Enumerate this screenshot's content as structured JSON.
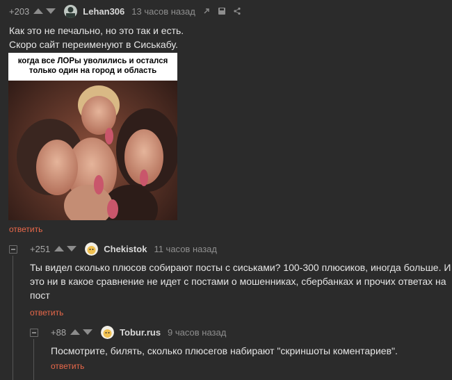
{
  "comments": [
    {
      "score": "+203",
      "user": "Lehan306",
      "time": "13 часов назад",
      "text_lines": [
        "Как это не печально, но это так и есть.",
        "Скоро сайт переименуют в Сиськабу."
      ],
      "image_caption": "когда все ЛОРы уволились и остался только один на город и область",
      "reply": "ответить"
    },
    {
      "score": "+251",
      "user": "Chekistok",
      "time": "11 часов назад",
      "text_lines": [
        "Ты видел сколько плюсов собирают посты с сиськами? 100-300 плюсиков, иногда больше. И",
        "это ни в какое сравнение не идет с постами о мошенниках, сбербанках и прочих ответах на",
        "пост"
      ],
      "reply": "ответить"
    },
    {
      "score": "+88",
      "user": "Tobur.rus",
      "time": "9 часов назад",
      "text_lines": [
        "Посмотрите, билять, сколько плюсегов набирают \"скриншоты коментариев\"."
      ],
      "reply": "ответить"
    }
  ],
  "icons": {
    "link": "link-icon",
    "save": "save-icon",
    "share": "share-icon"
  },
  "colors": {
    "background": "#2b2b2b",
    "reply_link": "#e8684a",
    "text": "#e6e6e6"
  }
}
